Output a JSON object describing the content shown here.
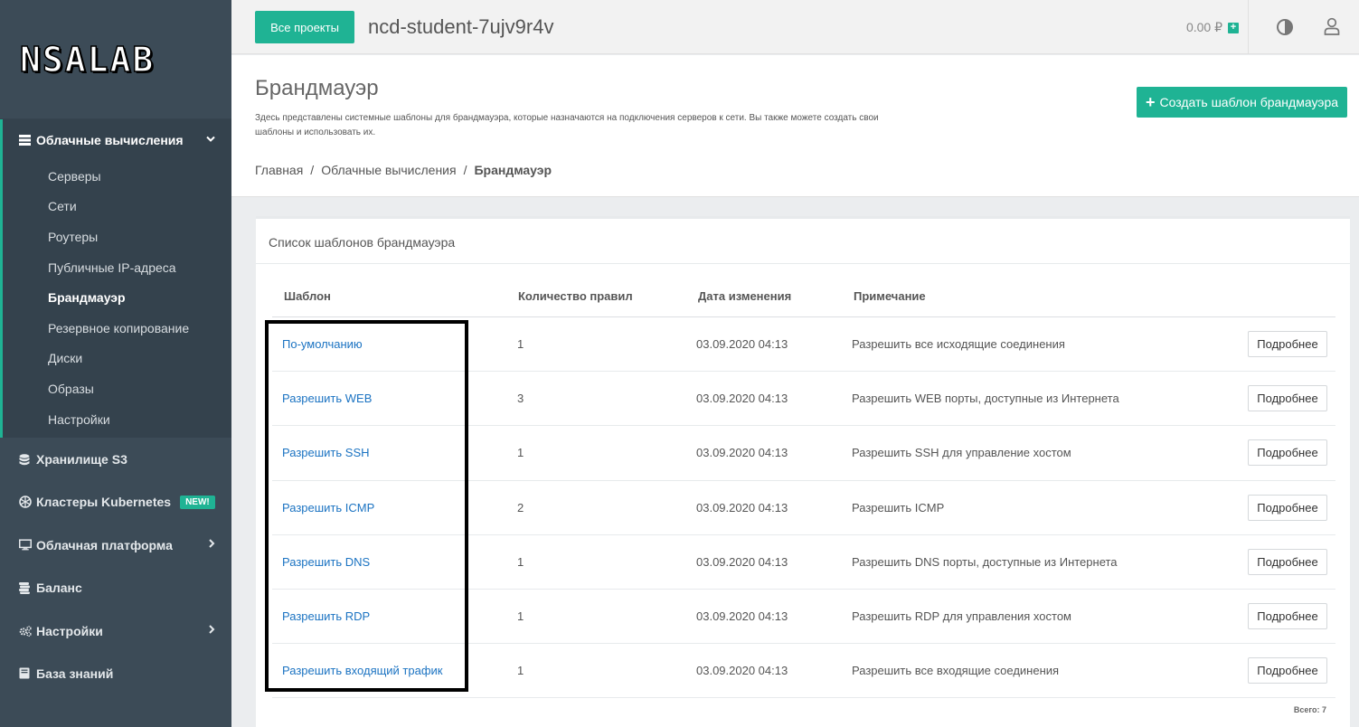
{
  "brand": {
    "logo": "NSALAB"
  },
  "sidebar": {
    "group": {
      "label": "Облачные вычисления",
      "items": [
        "Серверы",
        "Сети",
        "Роутеры",
        "Публичные IP-адреса",
        "Брандмауэр",
        "Резервное копирование",
        "Диски",
        "Образы",
        "Настройки"
      ],
      "active": "Брандмауэр"
    },
    "items": [
      {
        "label": "Хранилище S3",
        "icon": "database-icon"
      },
      {
        "label": "Кластеры Kubernetes",
        "icon": "kubernetes-icon",
        "badge": "NEW!"
      },
      {
        "label": "Облачная платформа",
        "icon": "monitor-icon"
      },
      {
        "label": "Баланс",
        "icon": "coins-icon"
      },
      {
        "label": "Настройки",
        "icon": "cogs-icon"
      },
      {
        "label": "База знаний",
        "icon": "book-icon"
      }
    ]
  },
  "topbar": {
    "projects_button": "Все проекты",
    "project_name": "ncd-student-7ujv9r4v",
    "balance": "0.00 ₽"
  },
  "header": {
    "title": "Брандмауэр",
    "description": "Здесь представлены системные шаблоны для брандмауэра, которые назначаются на подключения серверов к сети. Вы также можете создать свои шаблоны и использовать их.",
    "create_button": "Создать шаблон брандмауэра",
    "breadcrumb": [
      "Главная",
      "Облачные вычисления",
      "Брандмауэр"
    ]
  },
  "card": {
    "title": "Список шаблонов брандмауэра",
    "columns": [
      "Шаблон",
      "Количество правил",
      "Дата изменения",
      "Примечание"
    ],
    "rows": [
      {
        "name": "По-умолчанию",
        "rules": "1",
        "date": "03.09.2020 04:13",
        "note": "Разрешить все исходящие соединения"
      },
      {
        "name": "Разрешить WEB",
        "rules": "3",
        "date": "03.09.2020 04:13",
        "note": "Разрешить WEB порты, доступные из Интернета"
      },
      {
        "name": "Разрешить SSH",
        "rules": "1",
        "date": "03.09.2020 04:13",
        "note": "Разрешить SSH для управление хостом"
      },
      {
        "name": "Разрешить ICMP",
        "rules": "2",
        "date": "03.09.2020 04:13",
        "note": "Разрешить ICMP"
      },
      {
        "name": "Разрешить DNS",
        "rules": "1",
        "date": "03.09.2020 04:13",
        "note": "Разрешить DNS порты, доступные из Интернета"
      },
      {
        "name": "Разрешить RDP",
        "rules": "1",
        "date": "03.09.2020 04:13",
        "note": "Разрешить RDP для управления хостом"
      },
      {
        "name": "Разрешить входящий трафик",
        "rules": "1",
        "date": "03.09.2020 04:13",
        "note": "Разрешить все входящие соединения"
      }
    ],
    "details_button": "Подробнее",
    "total": "Всего: 7"
  },
  "colors": {
    "accent": "#1fb394",
    "sidebar": "#3c4b57",
    "link": "#1b73c2"
  }
}
